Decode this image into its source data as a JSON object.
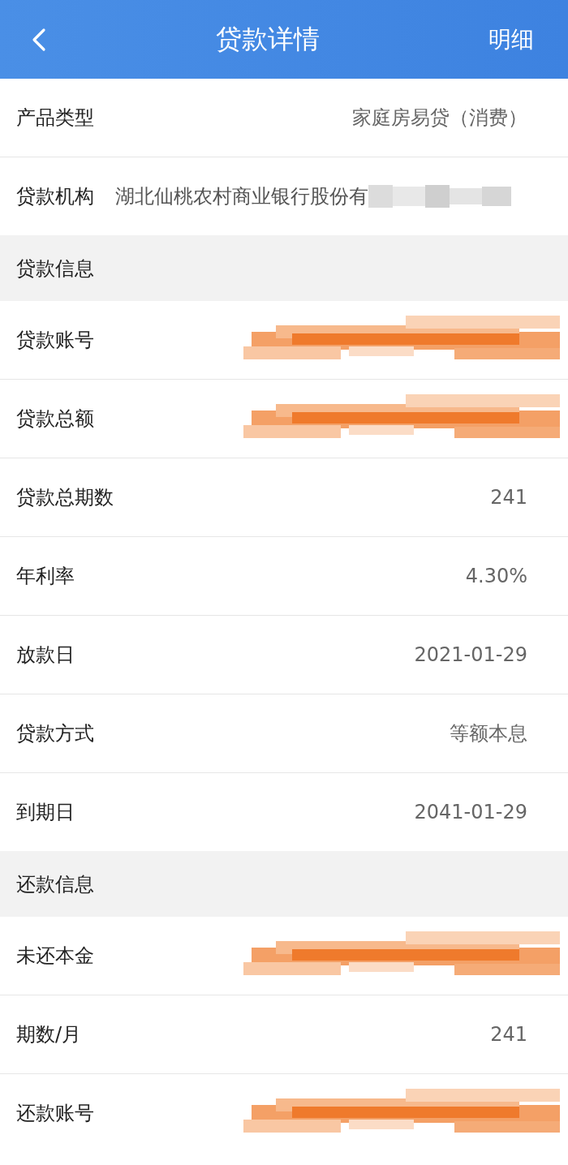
{
  "header": {
    "title": "贷款详情",
    "action": "明细"
  },
  "sections": [
    {
      "rows": [
        {
          "kind": "text",
          "label": "产品类型",
          "value": "家庭房易贷（消费）"
        },
        {
          "kind": "text_then_redacted",
          "label": "贷款机构",
          "value": "湖北仙桃农村商业银行股份有"
        }
      ]
    },
    {
      "title": "贷款信息",
      "rows": [
        {
          "kind": "redacted",
          "label": "贷款账号"
        },
        {
          "kind": "redacted",
          "label": "贷款总额"
        },
        {
          "kind": "text",
          "label": "贷款总期数",
          "value": "241"
        },
        {
          "kind": "text",
          "label": "年利率",
          "value": "4.30%"
        },
        {
          "kind": "text",
          "label": "放款日",
          "value": "2021-01-29"
        },
        {
          "kind": "text",
          "label": "贷款方式",
          "value": "等额本息"
        },
        {
          "kind": "text",
          "label": "到期日",
          "value": "2041-01-29"
        }
      ]
    },
    {
      "title": "还款信息",
      "rows": [
        {
          "kind": "redacted",
          "label": "未还本金"
        },
        {
          "kind": "text",
          "label": "期数/月",
          "value": "241"
        },
        {
          "kind": "redacted",
          "label": "还款账号"
        }
      ]
    }
  ]
}
